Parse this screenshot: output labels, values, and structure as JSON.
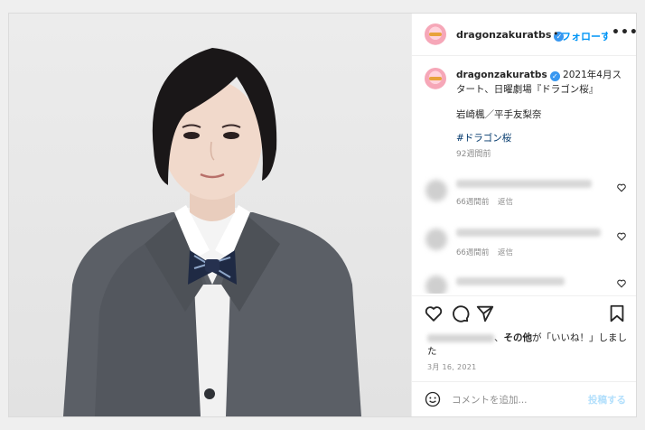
{
  "header": {
    "username": "dragonzakuratbs",
    "verified_mark": "✓",
    "separator": "•",
    "follow_label": "フォローする",
    "more_label": "•••"
  },
  "caption": {
    "username": "dragonzakuratbs",
    "verified_mark": "✓",
    "line1": "2021年4月スタート、日曜劇場『ドラゴン桜』",
    "line2": "岩崎楓／平手友梨奈",
    "hashtag": "#ドラゴン桜",
    "age": "92週間前"
  },
  "comments": [
    {
      "age": "66週間前",
      "reply": "返信"
    },
    {
      "age": "66週間前",
      "reply": "返信"
    },
    {
      "age": "",
      "reply": ""
    }
  ],
  "likes": {
    "others_bold": "その他",
    "text_suffix": "が「いいね！」しました"
  },
  "post_date": "3月 16, 2021",
  "add_comment": {
    "placeholder": "コメントを追加...",
    "post_label": "投稿する"
  },
  "icons": [
    "heart-icon",
    "comment-icon",
    "share-icon",
    "save-icon",
    "emoji-icon",
    "more-icon",
    "verified-icon"
  ],
  "colors": {
    "accent": "#0095f6",
    "text": "#262626",
    "muted": "#8e8e8e",
    "post_disabled": "#b2dffc"
  }
}
